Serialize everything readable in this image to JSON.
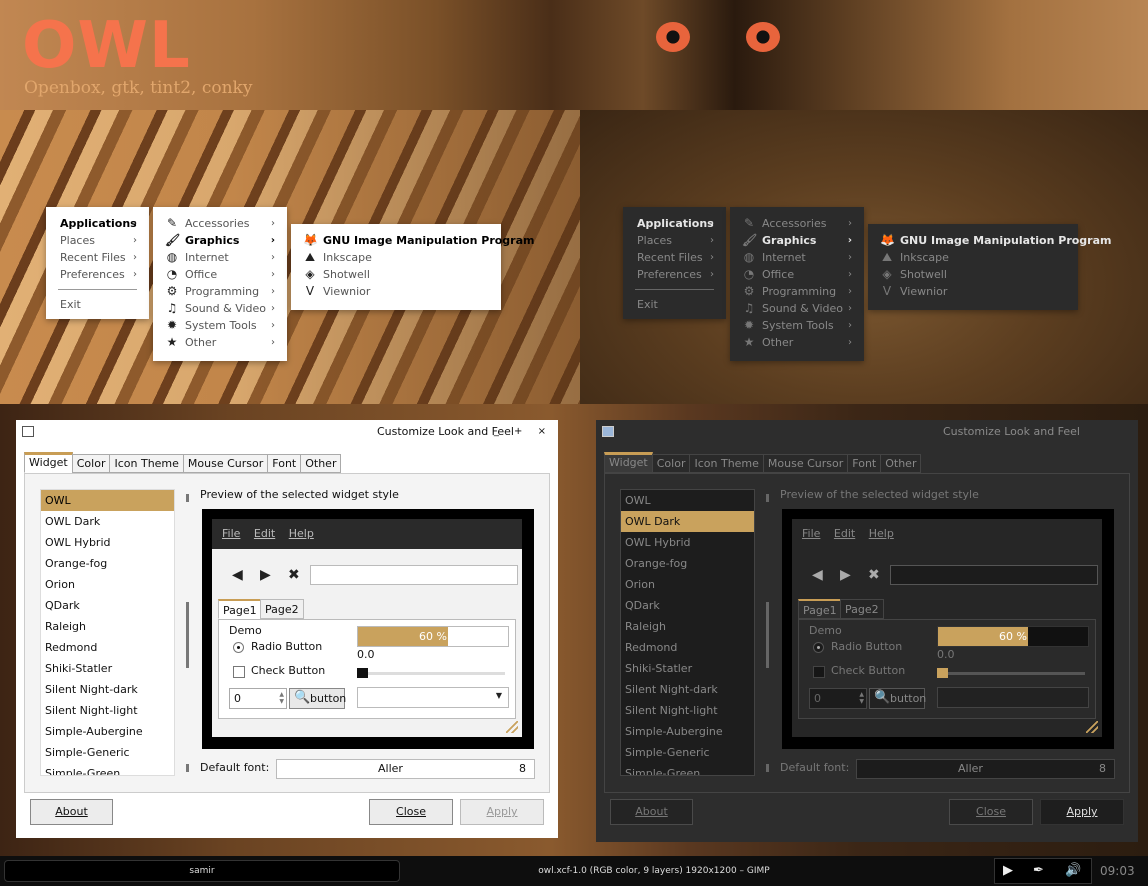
{
  "banner": {
    "title": "OWL",
    "subtitle": "Openbox, gtk, tint2, conky"
  },
  "colors": {
    "accent": "#c9a25d",
    "title": "#f5734c",
    "subtitle": "#e1a66c"
  },
  "menus": {
    "root": {
      "items": [
        "Applications",
        "Places",
        "Recent Files",
        "Preferences"
      ],
      "exit": "Exit"
    },
    "apps": {
      "items": [
        {
          "label": "Accessories",
          "icon": "accessories-icon"
        },
        {
          "label": "Graphics",
          "icon": "graphics-icon"
        },
        {
          "label": "Internet",
          "icon": "internet-icon"
        },
        {
          "label": "Office",
          "icon": "office-icon"
        },
        {
          "label": "Programming",
          "icon": "programming-icon"
        },
        {
          "label": "Sound & Video",
          "icon": "sound-video-icon"
        },
        {
          "label": "System Tools",
          "icon": "system-tools-icon"
        },
        {
          "label": "Other",
          "icon": "star-icon"
        }
      ]
    },
    "graphics": {
      "items": [
        {
          "label": "GNU Image Manipulation Program",
          "icon": "gimp-icon"
        },
        {
          "label": "Inkscape",
          "icon": "inkscape-icon"
        },
        {
          "label": "Shotwell",
          "icon": "shotwell-icon"
        },
        {
          "label": "Viewnior",
          "icon": "viewnior-icon"
        }
      ]
    }
  },
  "dialog": {
    "title": "Customize Look and Feel",
    "tabs": [
      "Widget",
      "Color",
      "Icon Theme",
      "Mouse Cursor",
      "Font",
      "Other"
    ],
    "themes": [
      "OWL",
      "OWL Dark",
      "OWL Hybrid",
      "Orange-fog",
      "Orion",
      "QDark",
      "Raleigh",
      "Redmond",
      "Shiki-Statler",
      "Silent Night-dark",
      "Silent Night-light",
      "Simple-Aubergine",
      "Simple-Generic",
      "Simple-Green"
    ],
    "preview_label": "Preview of the selected widget style",
    "preview": {
      "menu": [
        "File",
        "Edit",
        "Help"
      ],
      "pages": [
        "Page1",
        "Page2"
      ],
      "demo": "Demo",
      "radio": "Radio Button",
      "check": "Check Button",
      "progress": 0.6,
      "progress_text": "60 %",
      "slider_value": "0.0",
      "spin_value": "0",
      "button": "button"
    },
    "font_label": "Default font:",
    "font_name": "Aller",
    "font_size": "8",
    "buttons": {
      "about": "About",
      "close": "Close",
      "apply": "Apply"
    }
  },
  "taskbar": {
    "user": "samir",
    "window_title": "owl.xcf-1.0 (RGB color, 9 layers) 1920x1200 – GIMP",
    "clock": "09:03"
  }
}
